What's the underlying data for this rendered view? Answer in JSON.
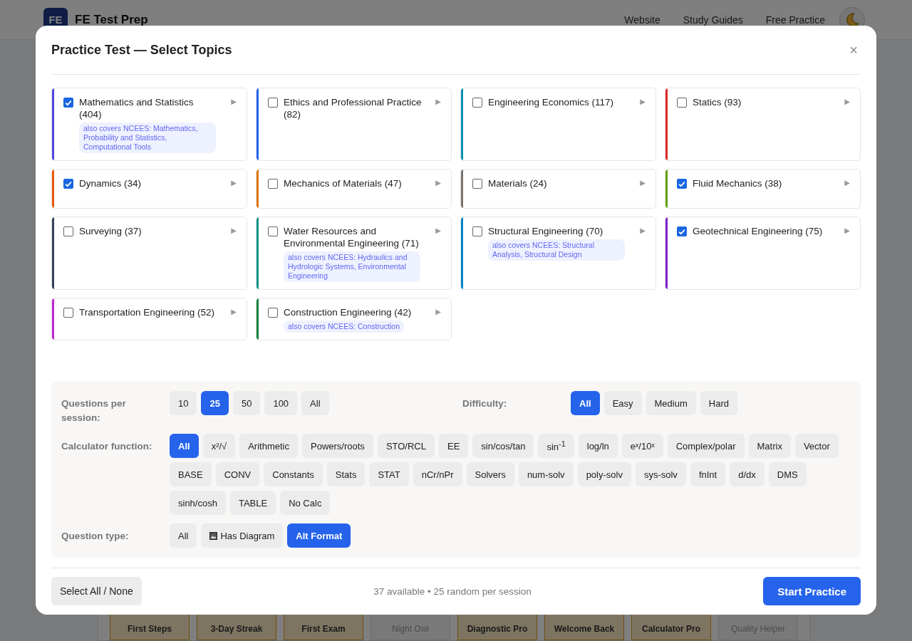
{
  "header": {
    "logo": "FE",
    "title": "FE Test Prep",
    "nav": [
      "Website",
      "Study Guides",
      "Free Practice"
    ]
  },
  "achievements": [
    {
      "label": "First Steps",
      "earned": true
    },
    {
      "label": "3-Day Streak",
      "earned": true
    },
    {
      "label": "First Exam",
      "earned": true
    },
    {
      "label": "Night Owl",
      "earned": false
    },
    {
      "label": "Diagnostic Pro",
      "earned": true
    },
    {
      "label": "Welcome Back",
      "earned": true
    },
    {
      "label": "Calculator Pro",
      "earned": true
    },
    {
      "label": "Quality Helper",
      "earned": false
    }
  ],
  "modal": {
    "title": "Practice Test — Select Topics",
    "close": "×",
    "topics": [
      {
        "label": "Mathematics and Statistics (404)",
        "checked": true,
        "color": "#4f46e5",
        "covers": "also covers NCEES: Mathematics, Probability and Statistics, Computational Tools"
      },
      {
        "label": "Ethics and Professional Practice (82)",
        "checked": false,
        "color": "#2563eb"
      },
      {
        "label": "Engineering Economics (117)",
        "checked": false,
        "color": "#0891b2"
      },
      {
        "label": "Statics (93)",
        "checked": false,
        "color": "#dc2626"
      },
      {
        "label": "Dynamics (34)",
        "checked": true,
        "color": "#ea580c"
      },
      {
        "label": "Mechanics of Materials (47)",
        "checked": false,
        "color": "#d97706"
      },
      {
        "label": "Materials (24)",
        "checked": false,
        "color": "#78716c"
      },
      {
        "label": "Fluid Mechanics (38)",
        "checked": true,
        "color": "#65a30d"
      },
      {
        "label": "Surveying (37)",
        "checked": false,
        "color": "#334155"
      },
      {
        "label": "Water Resources and Environmental Engineering (71)",
        "checked": false,
        "color": "#0d9488",
        "covers": "also covers NCEES: Hydraulics and Hydrologic Systems, Environmental Engineering"
      },
      {
        "label": "Structural Engineering (70)",
        "checked": false,
        "color": "#0284c7",
        "covers": "also covers NCEES: Structural Analysis, Structural Design"
      },
      {
        "label": "Geotechnical Engineering (75)",
        "checked": true,
        "color": "#7e22ce"
      },
      {
        "label": "Transportation Engineering (52)",
        "checked": false,
        "color": "#c026d3"
      },
      {
        "label": "Construction Engineering (42)",
        "checked": false,
        "color": "#15803d",
        "covers": "also covers NCEES: Construction"
      }
    ],
    "expand_icon": "▶",
    "questions": {
      "label": "Questions per session:",
      "options": [
        {
          "label": "10",
          "selected": false
        },
        {
          "label": "25",
          "selected": true
        },
        {
          "label": "50",
          "selected": false
        },
        {
          "label": "100",
          "selected": false
        },
        {
          "label": "All",
          "selected": false
        }
      ]
    },
    "difficulty": {
      "label": "Difficulty:",
      "options": [
        {
          "label": "All",
          "selected": true
        },
        {
          "label": "Easy",
          "selected": false
        },
        {
          "label": "Medium",
          "selected": false
        },
        {
          "label": "Hard",
          "selected": false
        }
      ]
    },
    "calculator": {
      "label": "Calculator function:",
      "options": [
        {
          "label": "All",
          "selected": true
        },
        {
          "label": "x²/√",
          "selected": false
        },
        {
          "label": "Arithmetic",
          "selected": false
        },
        {
          "label": "Powers/roots",
          "selected": false
        },
        {
          "label": "STO/RCL",
          "selected": false
        },
        {
          "label": "EE",
          "selected": false
        },
        {
          "label": "sin/cos/tan",
          "selected": false
        },
        {
          "label": "sin$^{-1}$",
          "selected": false
        },
        {
          "label": "log/ln",
          "selected": false
        },
        {
          "label": "eˣ/10ˣ",
          "selected": false
        },
        {
          "label": "Complex/polar",
          "selected": false
        },
        {
          "label": "Matrix",
          "selected": false
        },
        {
          "label": "Vector",
          "selected": false
        },
        {
          "label": "BASE",
          "selected": false
        },
        {
          "label": "CONV",
          "selected": false
        },
        {
          "label": "Constants",
          "selected": false
        },
        {
          "label": "Stats",
          "selected": false
        },
        {
          "label": "STAT",
          "selected": false
        },
        {
          "label": "nCr/nPr",
          "selected": false
        },
        {
          "label": "Solvers",
          "selected": false
        },
        {
          "label": "num-solv",
          "selected": false
        },
        {
          "label": "poly-solv",
          "selected": false
        },
        {
          "label": "sys-solv",
          "selected": false
        },
        {
          "label": "fnInt",
          "selected": false
        },
        {
          "label": "d/dx",
          "selected": false
        },
        {
          "label": "DMS",
          "selected": false
        },
        {
          "label": "sinh/cosh",
          "selected": false
        },
        {
          "label": "TABLE",
          "selected": false
        },
        {
          "label": "No Calc",
          "selected": false
        }
      ]
    },
    "question_type": {
      "label": "Question type:",
      "options": [
        {
          "label": "All",
          "selected": false
        },
        {
          "label": "Has Diagram",
          "selected": false,
          "kind": "picture"
        },
        {
          "label": "Alt Format",
          "selected": true
        }
      ]
    },
    "select_all": "Select All / None",
    "summary": "37 available • 25 random per session",
    "start": "Start Practice"
  }
}
